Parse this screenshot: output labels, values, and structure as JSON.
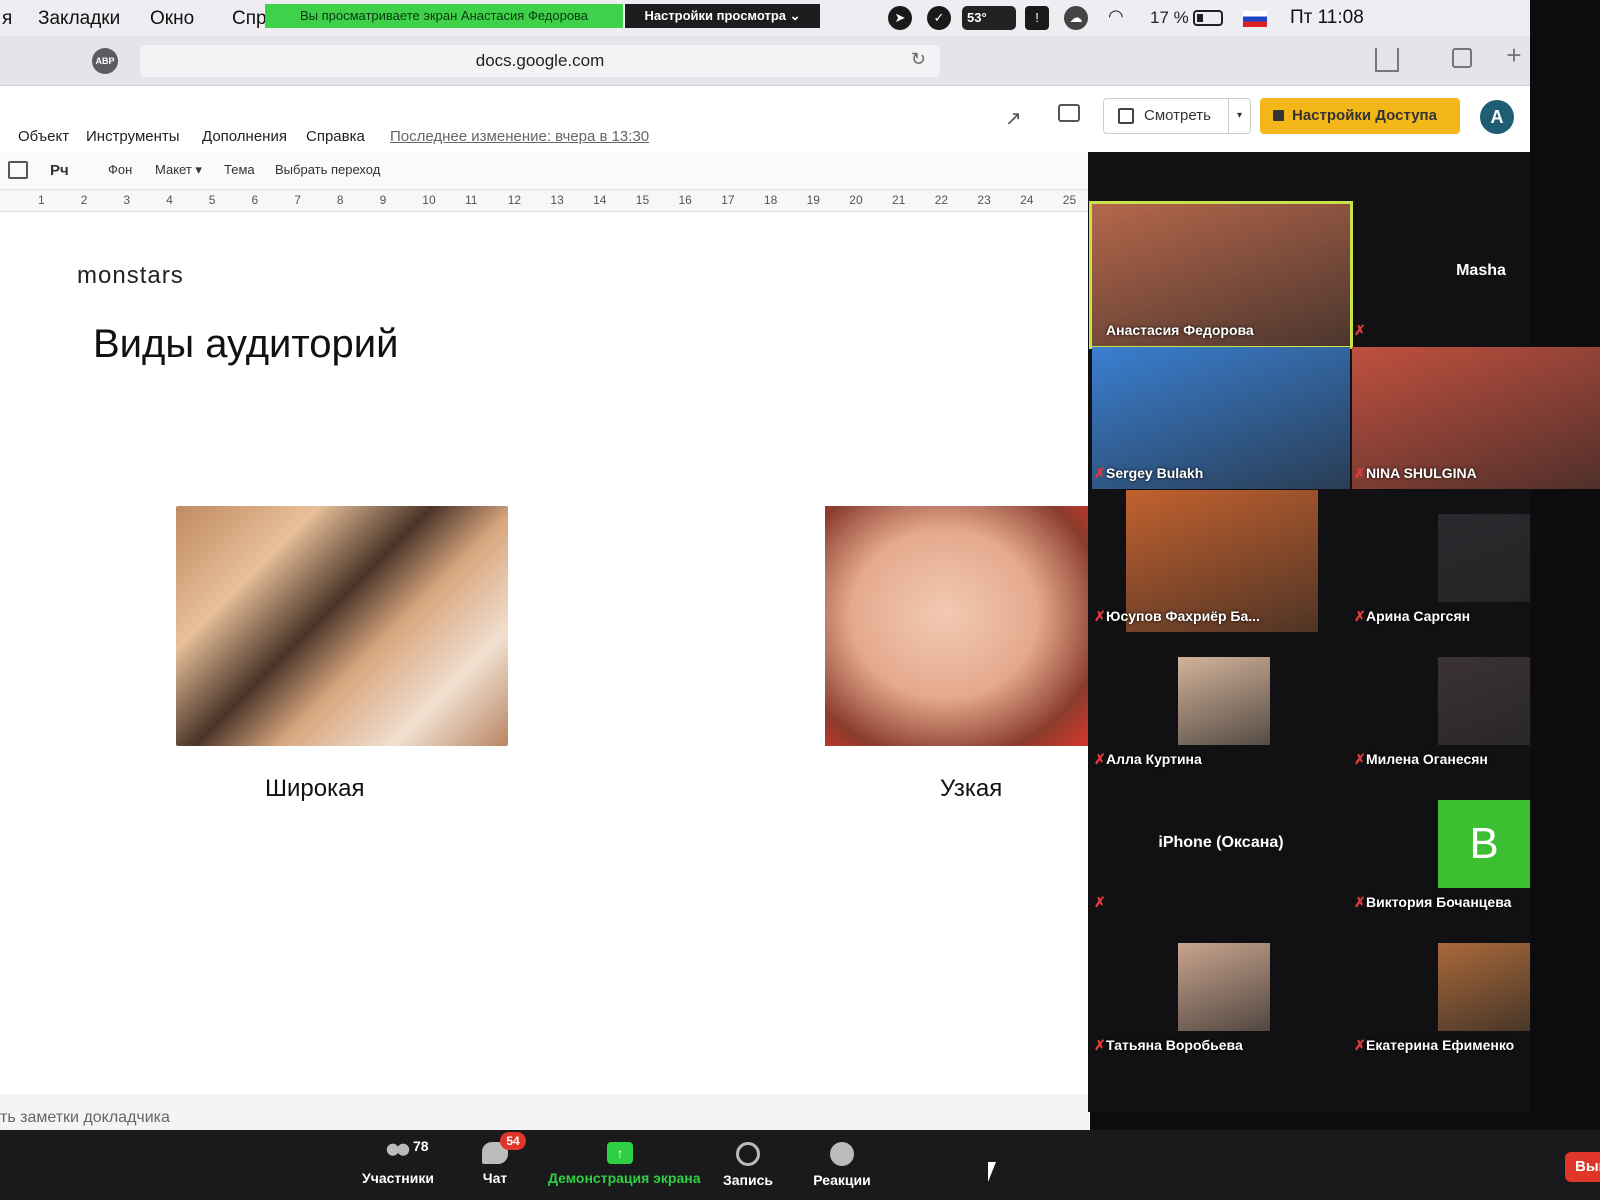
{
  "menubar": {
    "items": [
      "я",
      "Закладки",
      "Окно",
      "Спра"
    ],
    "share_banner": "Вы просматриваете экран Анастасия Федорова",
    "view_options": "Настройки просмотра ⌄",
    "temperature": "53°",
    "battery": "17 %",
    "clock": "Пт 11:08"
  },
  "browser": {
    "adblock_badge": "ABP",
    "url": "docs.google.com",
    "reload_icon": "↻",
    "new_tab": "+"
  },
  "docs": {
    "menu": [
      "Объект",
      "Инструменты",
      "Дополнения",
      "Справка"
    ],
    "last_edit": "Последнее изменение: вчера в 13:30",
    "trend_icon": "↗",
    "watch_label": "Смотреть",
    "watch_caret": "▾",
    "access_label": "Настройки Доступа",
    "avatar_letter": "A"
  },
  "toolbar": {
    "items": [
      "Рч",
      "Фон",
      "Макет ▾",
      "Тема",
      "Выбрать переход"
    ]
  },
  "ruler": [
    "1",
    "2",
    "3",
    "4",
    "5",
    "6",
    "7",
    "8",
    "9",
    "10",
    "11",
    "12",
    "13",
    "14",
    "15",
    "16",
    "17",
    "18",
    "19",
    "20",
    "21",
    "22",
    "23",
    "24",
    "25"
  ],
  "slide": {
    "logo": "monstars",
    "title": "Виды аудиторий",
    "caption_wide": "Широкая",
    "caption_narrow": "Узкая",
    "notes_placeholder": "ть заметки докладчика"
  },
  "gallery": {
    "mute_glyph": "✗",
    "participants": [
      {
        "name": "Анастасия Федорова",
        "video": true,
        "active": true,
        "muted": false,
        "color": "#b5674b"
      },
      {
        "name": "Masha",
        "video": false,
        "muted": true
      },
      {
        "name": "Sergey Bulakh",
        "video": true,
        "muted": true,
        "color": "#3a7fd1"
      },
      {
        "name": "NINA SHULGINA",
        "video": true,
        "muted": true,
        "color": "#c0503f"
      },
      {
        "name": "Юсупов Фахриёр Ба...",
        "video": true,
        "muted": true,
        "color": "#c2612f"
      },
      {
        "name": "Арина Саргсян",
        "video": true,
        "muted": true,
        "color": "#2a2a2e"
      },
      {
        "name": "Алла Куртина",
        "video": true,
        "muted": true,
        "color": "#d3b39a"
      },
      {
        "name": "Милена Оганесян",
        "video": true,
        "muted": true,
        "color": "#3b3234"
      },
      {
        "name": "iPhone (Оксана)",
        "video": false,
        "muted": true
      },
      {
        "name": "Виктория Бочанцева",
        "video": false,
        "avatar_letter": "B",
        "muted": true
      },
      {
        "name": "Татьяна Воробьева",
        "video": true,
        "muted": true,
        "color": "#c9a48e"
      },
      {
        "name": "Екатерина Ефименко",
        "video": true,
        "muted": true,
        "color": "#a9693a"
      }
    ]
  },
  "controls": {
    "participants_label": "Участники",
    "participants_count": "78",
    "chat_label": "Чат",
    "chat_badge": "54",
    "share_label": "Демонстрация экрана",
    "share_glyph": "↑",
    "record_label": "Запись",
    "reactions_label": "Реакции",
    "leave_label": "Вый"
  },
  "colors": {
    "share_green": "#3fd14a",
    "access_yellow": "#f3b71a",
    "mute_red": "#e03a3a",
    "avatar_green": "#3cc032"
  }
}
